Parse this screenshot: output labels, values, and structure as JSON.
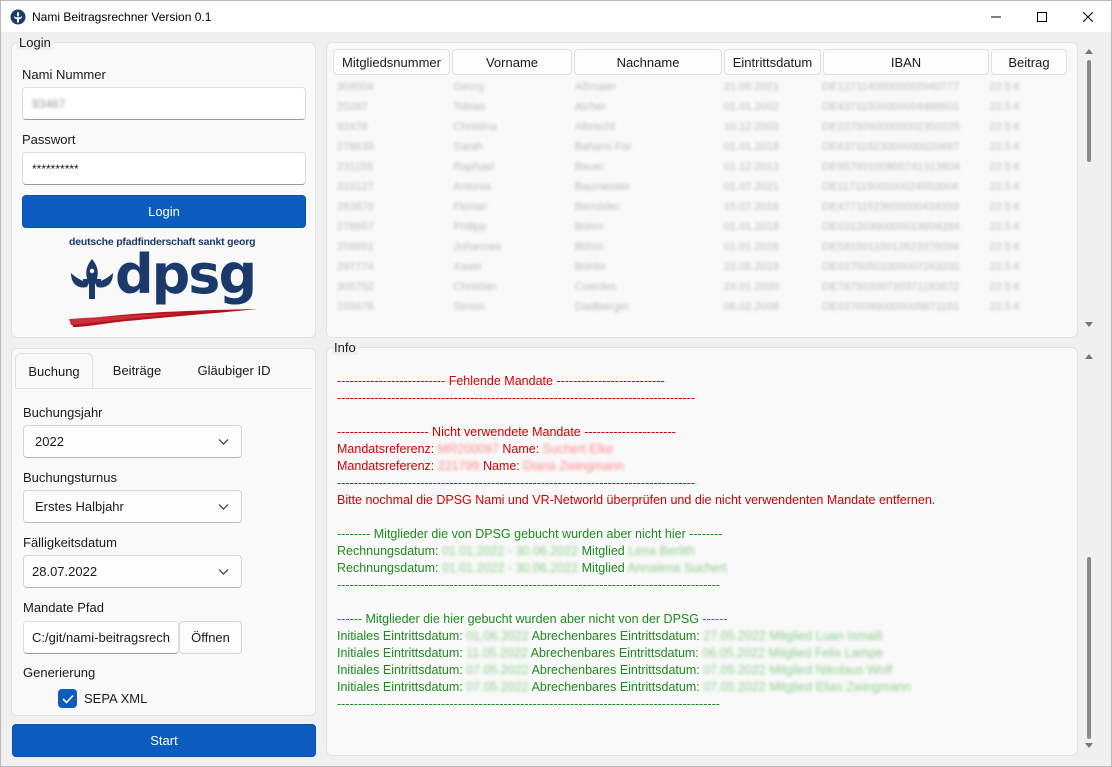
{
  "window": {
    "title": "Nami Beitragsrechner Version 0.1"
  },
  "login": {
    "group_title": "Login",
    "nami_label": "Nami Nummer",
    "nami_value": "93467",
    "password_label": "Passwort",
    "password_value": "**********",
    "login_button": "Login",
    "logo_tagline": "deutsche pfadfinderschaft sankt georg",
    "logo_text": "dpsg"
  },
  "tabs": {
    "items": [
      "Buchung",
      "Beiträge",
      "Gläubiger ID"
    ],
    "active": "Buchung"
  },
  "buchung": {
    "jahr_label": "Buchungsjahr",
    "jahr_value": "2022",
    "turnus_label": "Buchungsturnus",
    "turnus_value": "Erstes Halbjahr",
    "faellig_label": "Fälligkeitsdatum",
    "faellig_value": "28.07.2022",
    "pfad_label": "Mandate Pfad",
    "pfad_value": "C:/git/nami-beitragsrech",
    "open_button": "Öffnen",
    "gen_label": "Generierung",
    "sepa_label": "SEPA XML",
    "sepa_checked": true
  },
  "start_button": "Start",
  "table": {
    "columns": [
      "Mitgliedsnummer",
      "Vorname",
      "Nachname",
      "Eintrittsdatum",
      "IBAN",
      "Beitrag"
    ],
    "rows": [
      [
        "308504",
        "Georg",
        "Aßmaier",
        "21.06.2021",
        "DE12711400000002940777",
        "22.5 €"
      ],
      [
        "25287",
        "Tobias",
        "Aicher",
        "01.01.2002",
        "DE43711500000004488601",
        "22.5 €"
      ],
      [
        "92478",
        "Christina",
        "Albrecht",
        "10.12.2003",
        "DE22750900000002350225",
        "22.5 €"
      ],
      [
        "278639",
        "Sarah",
        "Bahami Far",
        "01.01.2018",
        "DE63711623000000020687",
        "22.5 €"
      ],
      [
        "231155",
        "Raphael",
        "Bauer",
        "01.12.2013",
        "DE95760100800741313804",
        "22.5 €"
      ],
      [
        "310127",
        "Antonia",
        "Baumeister",
        "01.07.2021",
        "DE11711500000024553004",
        "22.5 €"
      ],
      [
        "283870",
        "Florian",
        "Bernöder",
        "15.07.2018",
        "DE47711523600000424333",
        "22.5 €"
      ],
      [
        "278657",
        "Philipp",
        "Böhm",
        "01.01.2018",
        "DE03120300000013004284",
        "22.5 €"
      ],
      [
        "258691",
        "Johannes",
        "Böhm",
        "01.01.2016",
        "DE58100110012623376094",
        "22.5 €"
      ],
      [
        "297774",
        "Xaver",
        "Böhler",
        "22.05.2019",
        "DE03750501000007263331",
        "22.5 €"
      ],
      [
        "305752",
        "Christian",
        "Coerdes",
        "24.01.2020",
        "DE78750200730371193872",
        "22.5 €"
      ],
      [
        "155678",
        "Simon",
        "Dadlberger",
        "06.02.2008",
        "DE03700900000005671181",
        "22.5 €"
      ]
    ]
  },
  "info": {
    "group_title": "Info",
    "lines": [
      {
        "color": "red",
        "parts": [
          {
            "t": "-------------------------- Fehlende Mandate --------------------------"
          }
        ]
      },
      {
        "color": "red",
        "parts": [
          {
            "t": "--------------------------------------------------------------------------------------"
          }
        ]
      },
      {
        "color": "red",
        "parts": [
          {
            "t": ""
          }
        ]
      },
      {
        "color": "red",
        "parts": [
          {
            "t": "---------------------- Nicht verwendete Mandate ----------------------"
          }
        ]
      },
      {
        "color": "red",
        "parts": [
          {
            "t": "Mandatsreferenz: "
          },
          {
            "t": "MR200097",
            "blur": true
          },
          {
            "t": " Name:  "
          },
          {
            "t": "Suchert Elke",
            "blur": true
          }
        ]
      },
      {
        "color": "red",
        "parts": [
          {
            "t": "Mandatsreferenz: "
          },
          {
            "t": "221799",
            "blur": true
          },
          {
            "t": " Name:  "
          },
          {
            "t": "Diana Zwingmann",
            "blur": true
          }
        ]
      },
      {
        "color": "red",
        "parts": [
          {
            "t": "--------------------------------------------------------------------------------------"
          }
        ]
      },
      {
        "color": "red",
        "parts": [
          {
            "t": "Bitte nochmal die DPSG Nami und VR-Networld überprüfen und die nicht verwendenten Mandate entfernen."
          }
        ]
      },
      {
        "color": "green",
        "parts": [
          {
            "t": ""
          }
        ]
      },
      {
        "color": "green",
        "parts": [
          {
            "t": "-------- Mitglieder die von DPSG gebucht wurden aber nicht hier --------"
          }
        ]
      },
      {
        "color": "green",
        "parts": [
          {
            "t": "Rechnungsdatum: "
          },
          {
            "t": "01.01.2022 - 30.06.2022",
            "blur": true
          },
          {
            "t": " Mitglied "
          },
          {
            "t": "Lena Berlith",
            "blur": true
          }
        ]
      },
      {
        "color": "green",
        "parts": [
          {
            "t": "Rechnungsdatum: "
          },
          {
            "t": "01.01.2022 - 30.06.2022",
            "blur": true
          },
          {
            "t": " Mitglied "
          },
          {
            "t": "Annalena Suchert",
            "blur": true
          }
        ]
      },
      {
        "color": "green",
        "parts": [
          {
            "t": "--------------------------------------------------------------------------------------------"
          }
        ]
      },
      {
        "color": "green",
        "parts": [
          {
            "t": ""
          }
        ]
      },
      {
        "color": "green",
        "parts": [
          {
            "t": "------ Mitglieder die hier gebucht wurden aber nicht von der DPSG ------"
          }
        ]
      },
      {
        "color": "green",
        "parts": [
          {
            "t": "Initiales Eintrittsdatum: "
          },
          {
            "t": "01.06.2022",
            "blur": true
          },
          {
            "t": " Abrechenbares Eintrittsdatum: "
          },
          {
            "t": "27.05.2022 Mitglied Luan Ismaili",
            "blur": true
          }
        ]
      },
      {
        "color": "green",
        "parts": [
          {
            "t": "Initiales Eintrittsdatum: "
          },
          {
            "t": "11.05.2022",
            "blur": true
          },
          {
            "t": " Abrechenbares Eintrittsdatum: "
          },
          {
            "t": "06.05.2022 Mitglied Felix Lampe",
            "blur": true
          }
        ]
      },
      {
        "color": "green",
        "parts": [
          {
            "t": "Initiales Eintrittsdatum: "
          },
          {
            "t": "07.05.2022",
            "blur": true
          },
          {
            "t": " Abrechenbares Eintrittsdatum: "
          },
          {
            "t": "07.05.2022 Mitglied Nikolaus Wolf",
            "blur": true
          }
        ]
      },
      {
        "color": "green",
        "parts": [
          {
            "t": "Initiales Eintrittsdatum: "
          },
          {
            "t": "07.05.2022",
            "blur": true
          },
          {
            "t": " Abrechenbares Eintrittsdatum: "
          },
          {
            "t": "07.05.2022 Mitglied Elias Zwingmann",
            "blur": true
          }
        ]
      },
      {
        "color": "green",
        "parts": [
          {
            "t": "--------------------------------------------------------------------------------------------"
          }
        ]
      }
    ]
  },
  "colors": {
    "accent": "#0c5cbf",
    "logo_blue": "#1b3a6b",
    "logo_red": "#b5121b",
    "log_red": "#d40000",
    "log_green": "#1f8a1f"
  }
}
